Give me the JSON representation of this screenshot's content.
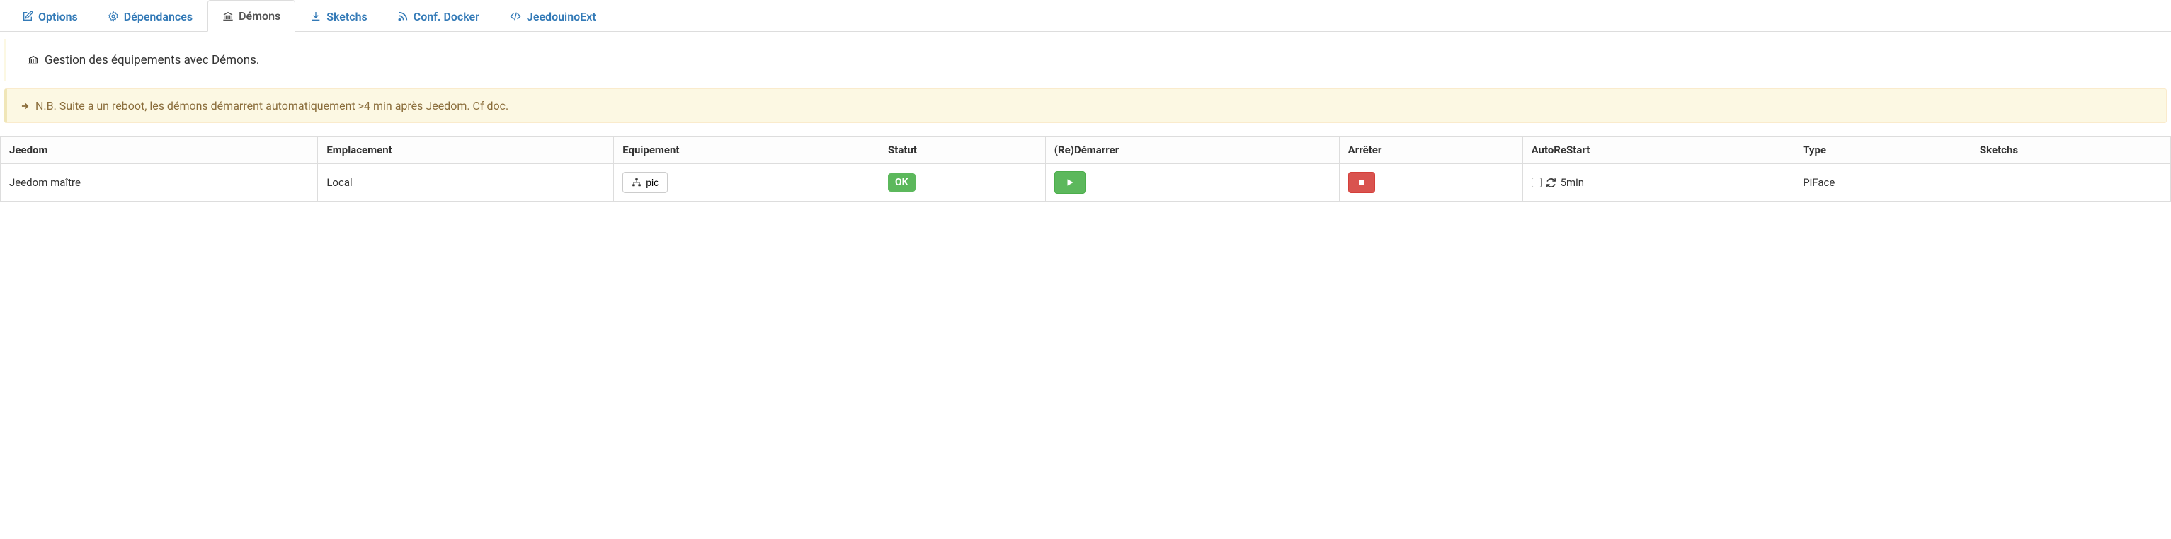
{
  "tabs": [
    {
      "icon": "edit-icon",
      "label": "Options"
    },
    {
      "icon": "cog-icon",
      "label": "Dépendances"
    },
    {
      "icon": "university-icon",
      "label": "Démons",
      "active": true
    },
    {
      "icon": "download-icon",
      "label": "Sketchs"
    },
    {
      "icon": "rss-icon",
      "label": "Conf. Docker"
    },
    {
      "icon": "code-icon",
      "label": "JeedouinoExt"
    }
  ],
  "panel_title": "Gestion des équipements avec Démons.",
  "alert": "N.B. Suite a un reboot, les démons démarrent automatiquement >4 min après Jeedom. Cf doc.",
  "table": {
    "headers": [
      "Jeedom",
      "Emplacement",
      "Equipement",
      "Statut",
      "(Re)Démarrer",
      "Arrêter",
      "AutoReStart",
      "Type",
      "Sketchs"
    ],
    "rows": [
      {
        "jeedom": "Jeedom maître",
        "emplacement": "Local",
        "equipement": "pic",
        "statut": "OK",
        "autorestart_label": "5min",
        "autorestart_checked": false,
        "type": "PiFace",
        "sketchs": ""
      }
    ]
  }
}
